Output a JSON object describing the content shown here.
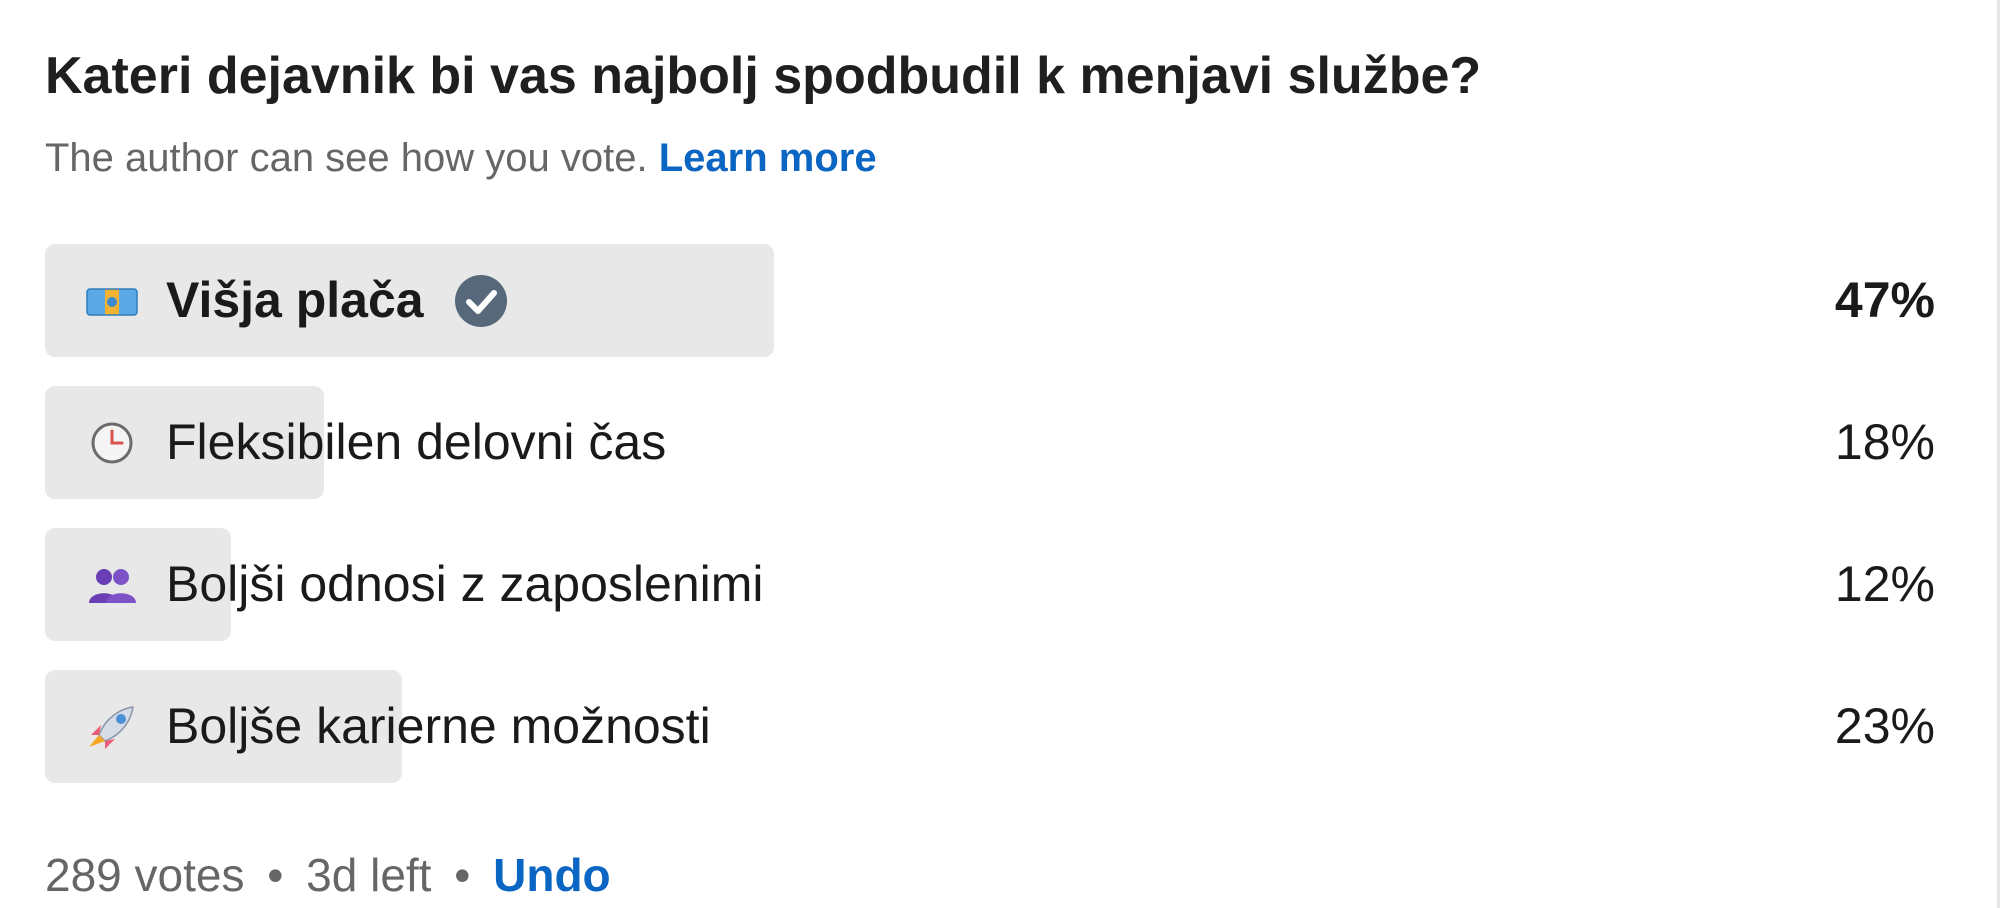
{
  "poll": {
    "question": "Kateri dejavnik bi vas najbolj spodbudil k menjavi službe?",
    "notice": "The author can see how you vote.",
    "learn_more": "Learn more",
    "options": [
      {
        "icon": "money-icon",
        "label": "Višja plača",
        "percent": "47%",
        "share": 0.47,
        "selected": true
      },
      {
        "icon": "clock-icon",
        "label": "Fleksibilen delovni čas",
        "percent": "18%",
        "share": 0.18,
        "selected": false
      },
      {
        "icon": "people-icon",
        "label": "Boljši odnosi z zaposlenimi",
        "percent": "12%",
        "share": 0.12,
        "selected": false
      },
      {
        "icon": "rocket-icon",
        "label": "Boljše karierne možnosti",
        "percent": "23%",
        "share": 0.23,
        "selected": false
      }
    ],
    "footer": {
      "votes": "289 votes",
      "separator": "•",
      "time_left": "3d left",
      "undo": "Undo"
    }
  },
  "colors": {
    "accent": "#0a66c2",
    "bar_fill": "#e8e8e8",
    "check_badge": "#56687a"
  }
}
